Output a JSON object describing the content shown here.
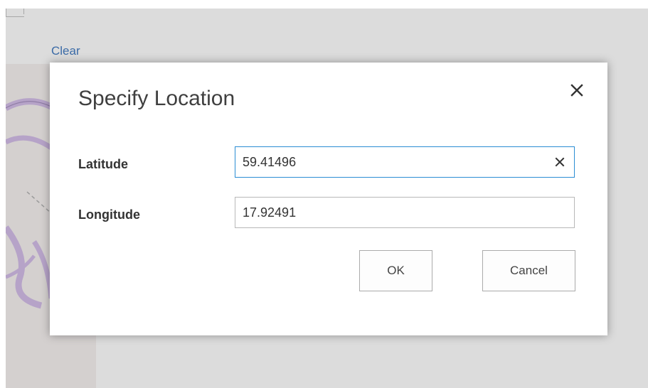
{
  "page": {
    "clear_link": "Clear"
  },
  "dialog": {
    "title": "Specify Location",
    "close_icon": "close-icon",
    "latitude": {
      "label": "Latitude",
      "value": "59.41496",
      "clear_icon": "clear-icon"
    },
    "longitude": {
      "label": "Longitude",
      "value": "17.92491"
    },
    "ok_label": "OK",
    "cancel_label": "Cancel"
  },
  "colors": {
    "link": "#3b6ba7",
    "focus_border": "#2a8dd4",
    "overlay": "#dcdcdc",
    "map_road": "#b6a3c8"
  }
}
